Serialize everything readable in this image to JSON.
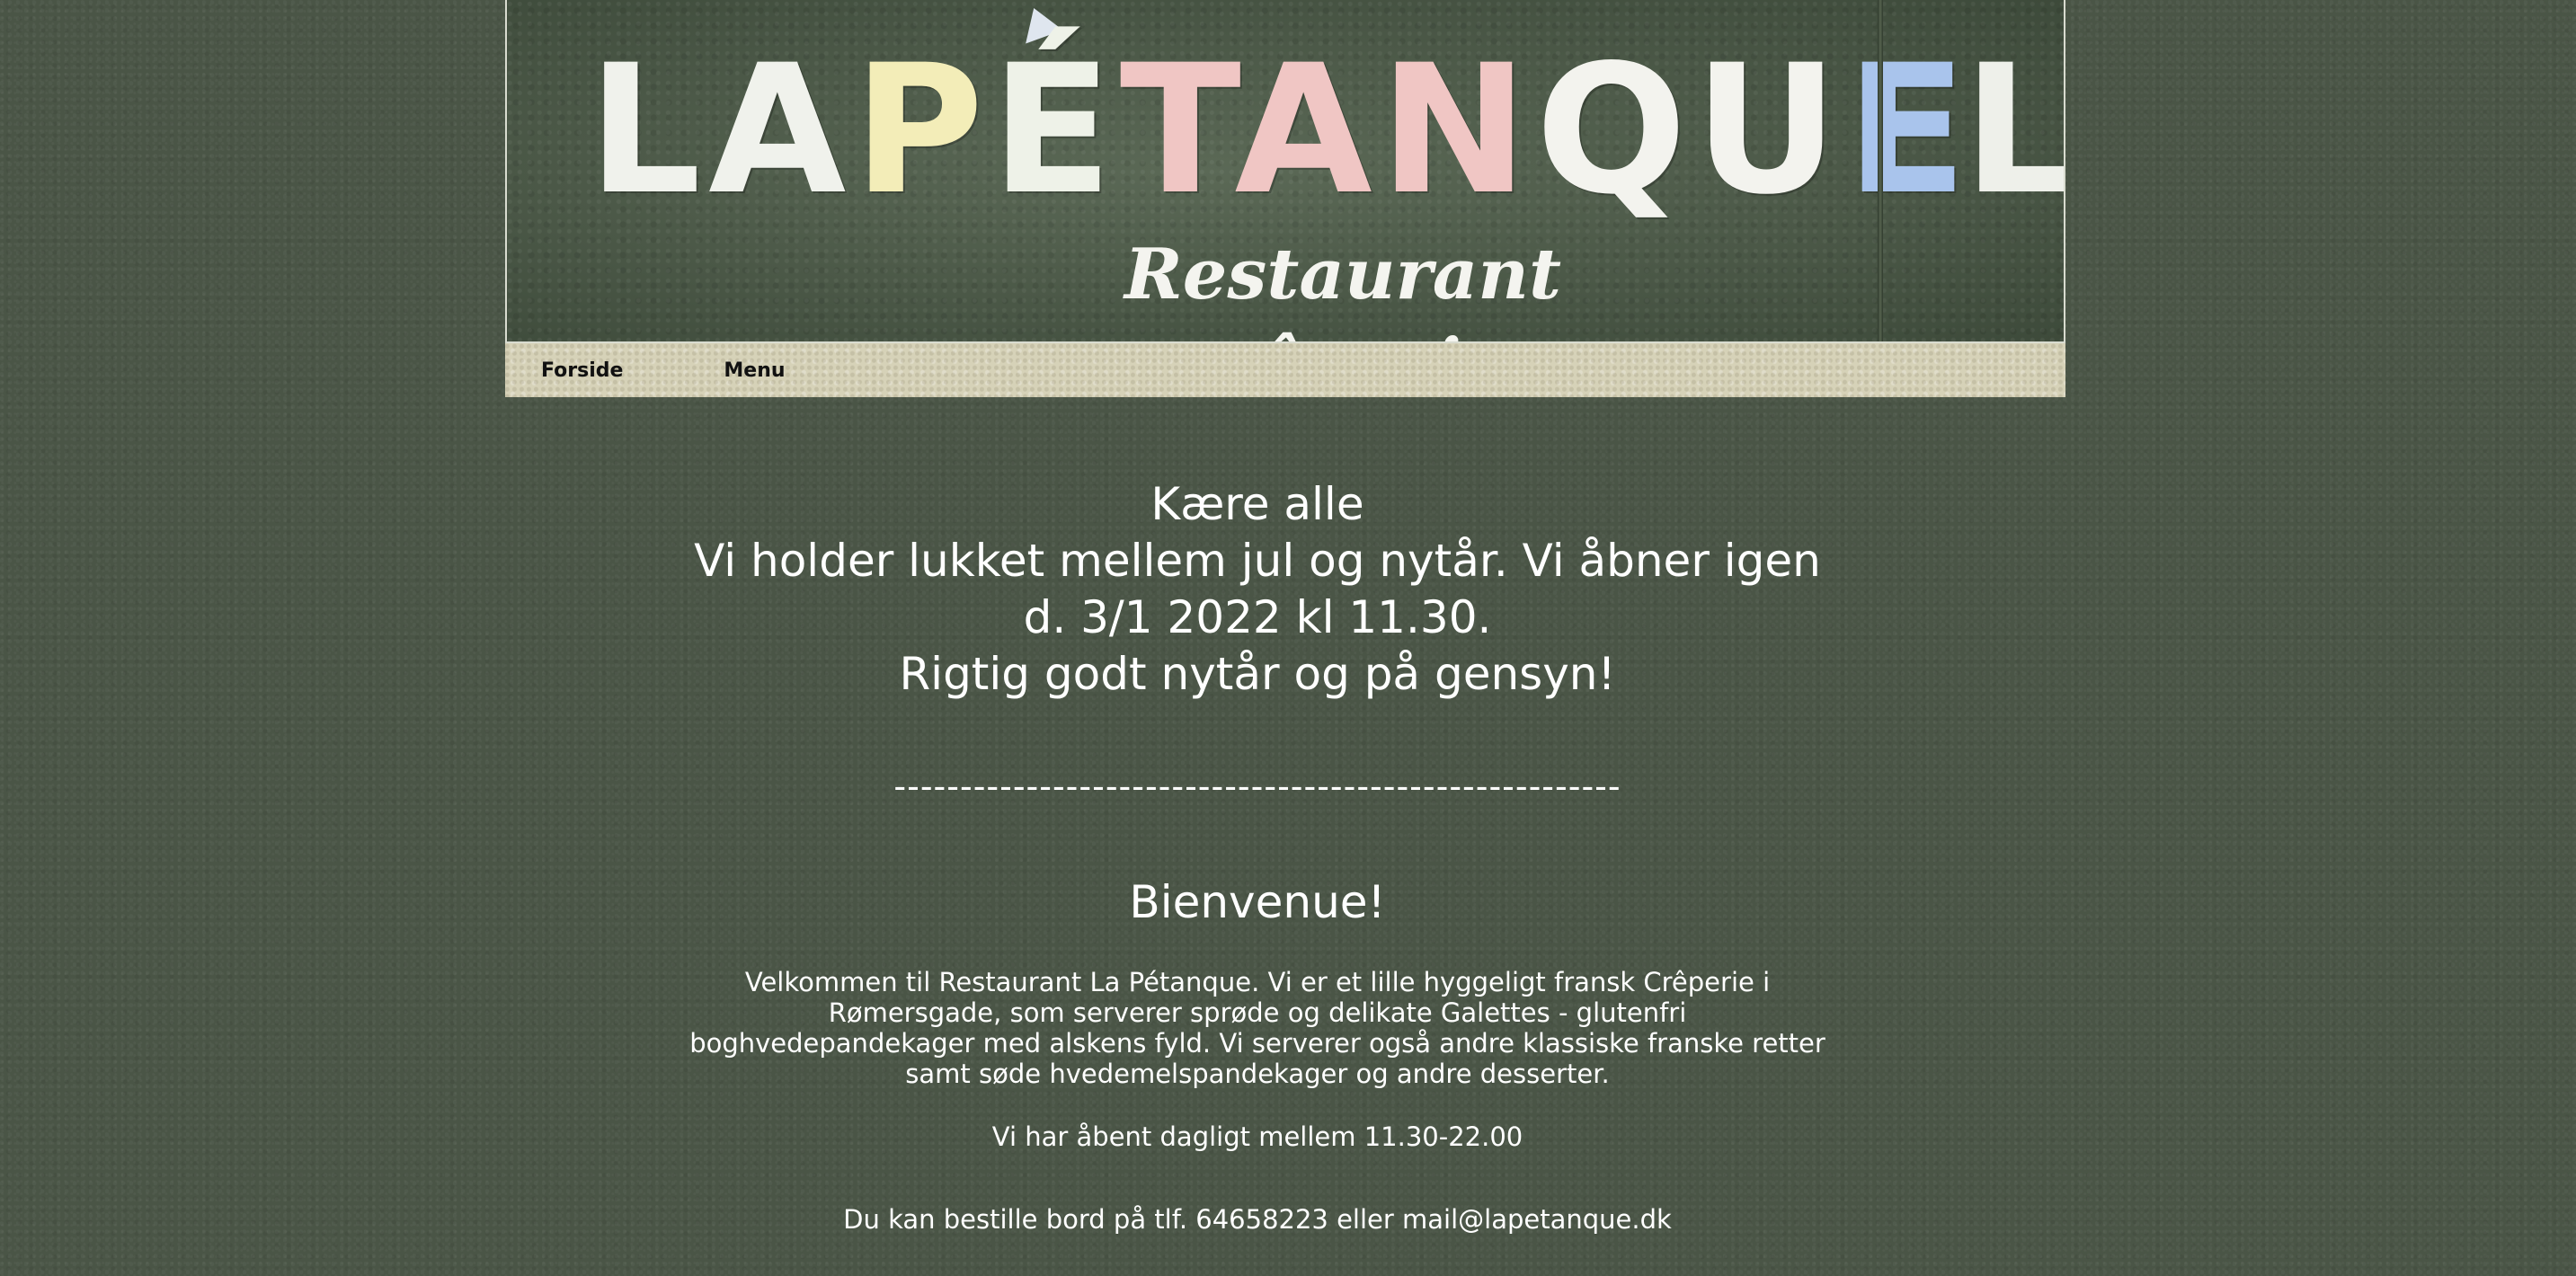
{
  "header": {
    "logo_text": "LA PÉTANQUE",
    "logo_parts": [
      "LA",
      "P",
      "É",
      "TAN",
      "QU",
      "E"
    ],
    "logo_right_fragment": "L",
    "subtitle": "Restaurant crêperie"
  },
  "nav": {
    "items": [
      {
        "label": "Forside"
      },
      {
        "label": "Menu"
      }
    ]
  },
  "notice": {
    "lines": [
      "Kære alle",
      "Vi holder lukket mellem jul og nytår. Vi åbner igen",
      "d. 3/1 2022 kl 11.30.",
      "Rigtig godt nytår og på gensyn!"
    ]
  },
  "divider": "-------------------------------------------------------",
  "welcome": {
    "title": "Bienvenue!",
    "intro": "Velkommen til Restaurant La Pétanque. Vi er et lille hyggeligt fransk Crêperie i Rømersgade, som serverer sprøde og delikate Galettes - glutenfri boghvedepandekager med alskens fyld. Vi serverer også andre klassiske franske retter samt søde hvedemelspandekager og andre desserter.",
    "hours": "Vi har åbent dagligt mellem 11.30-22.00",
    "booking": "Du kan bestille bord på  tlf. 64658223 eller mail@lapetanque.dk"
  },
  "colors": {
    "background": "#4a5546",
    "navbar": "#d6d2b8",
    "text": "#ffffff",
    "nav_text": "#111111"
  }
}
